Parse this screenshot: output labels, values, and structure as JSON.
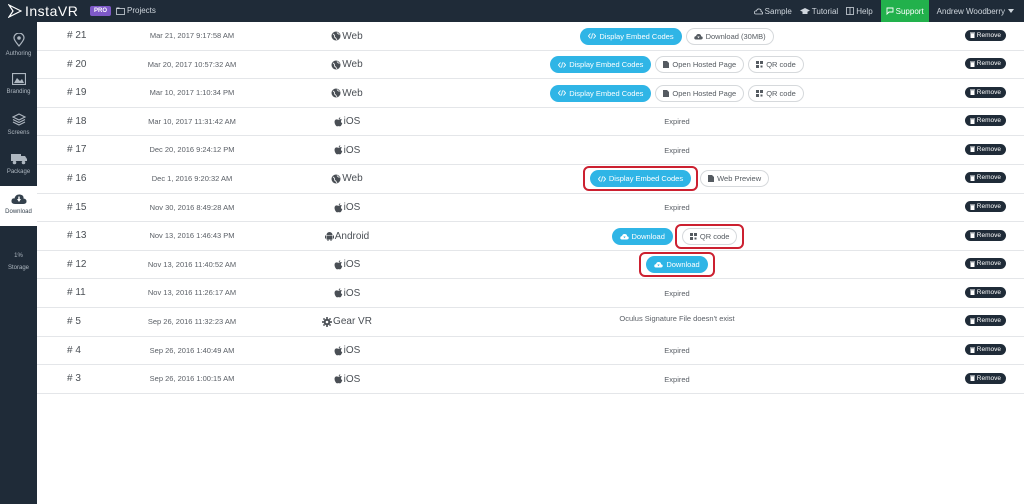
{
  "app": {
    "logo_text": "InstaVR",
    "pro_badge": "PRO",
    "projects_label": "Projects"
  },
  "topnav": {
    "sample": "Sample",
    "tutorial": "Tutorial",
    "help": "Help",
    "support": "Support",
    "user": "Andrew Woodberry"
  },
  "sidebar": {
    "items": [
      {
        "label": "Authoring",
        "icon": "map-pin-icon"
      },
      {
        "label": "Branding",
        "icon": "image-icon"
      },
      {
        "label": "Screens",
        "icon": "layers-icon"
      },
      {
        "label": "Package",
        "icon": "truck-icon"
      },
      {
        "label": "Download",
        "icon": "cloud-download-icon"
      }
    ],
    "storage_percent": "1%",
    "storage_label": "Storage"
  },
  "labels": {
    "remove": "Remove",
    "display_embed": "Display Embed Codes",
    "download_30mb": "Download (30MB)",
    "open_hosted": "Open Hosted Page",
    "qr_code": "QR code",
    "expired": "Expired",
    "web_preview": "Web Preview",
    "download": "Download",
    "oculus_error": "Oculus Signature File doesn't exist"
  },
  "rows": [
    {
      "id": "# 21",
      "date": "Mar 21, 2017 9:17:58 AM",
      "platform": "Web"
    },
    {
      "id": "# 20",
      "date": "Mar 20, 2017 10:57:32 AM",
      "platform": "Web"
    },
    {
      "id": "# 19",
      "date": "Mar 10, 2017 1:10:34 PM",
      "platform": "Web"
    },
    {
      "id": "# 18",
      "date": "Mar 10, 2017 11:31:42 AM",
      "platform": "iOS"
    },
    {
      "id": "# 17",
      "date": "Dec 20, 2016 9:24:12 PM",
      "platform": "iOS"
    },
    {
      "id": "# 16",
      "date": "Dec 1, 2016 9:20:32 AM",
      "platform": "Web"
    },
    {
      "id": "# 15",
      "date": "Nov 30, 2016 8:49:28 AM",
      "platform": "iOS"
    },
    {
      "id": "# 13",
      "date": "Nov 13, 2016 1:46:43 PM",
      "platform": "Android"
    },
    {
      "id": "# 12",
      "date": "Nov 13, 2016 11:40:52 AM",
      "platform": "iOS"
    },
    {
      "id": "# 11",
      "date": "Nov 13, 2016 11:26:17 AM",
      "platform": "iOS"
    },
    {
      "id": "# 5",
      "date": "Sep 26, 2016 11:32:23 AM",
      "platform": "Gear VR"
    },
    {
      "id": "# 4",
      "date": "Sep 26, 2016 1:40:49 AM",
      "platform": "iOS"
    },
    {
      "id": "# 3",
      "date": "Sep 26, 2016 1:00:15 AM",
      "platform": "iOS"
    }
  ],
  "colors": {
    "navbar": "#1f2b38",
    "primary_button": "#2fb5e6",
    "support_green": "#22b14c",
    "pro_purple": "#7e59c8",
    "highlight_red": "#cc2030"
  }
}
